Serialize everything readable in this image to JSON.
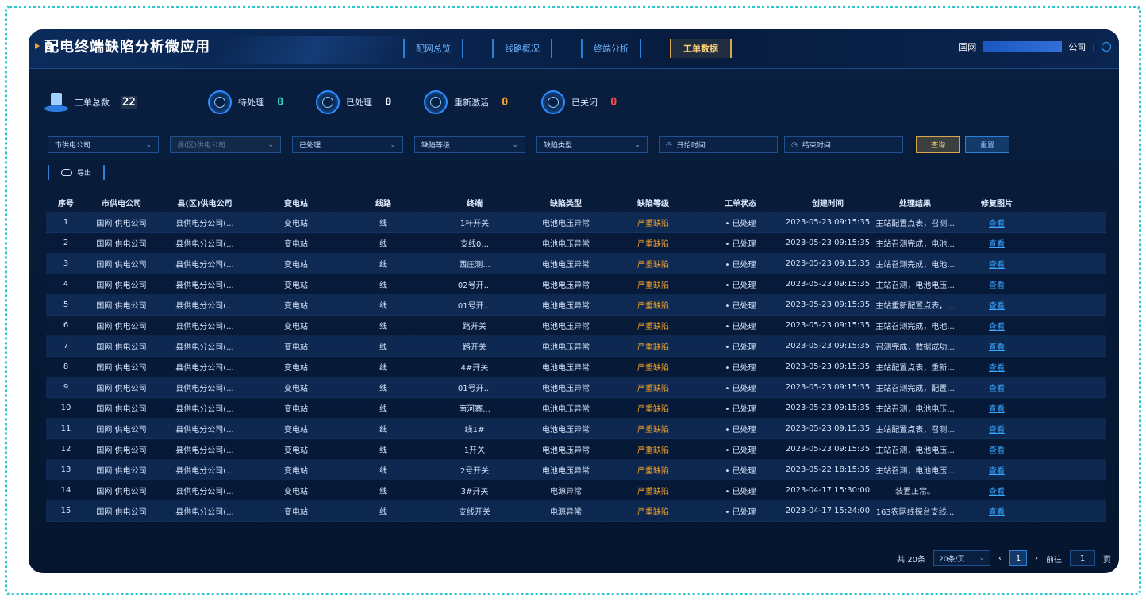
{
  "header": {
    "title": "配电终端缺陷分析微应用",
    "nav": [
      "配网总览",
      "线路概况",
      "终端分析",
      "工单数据"
    ],
    "active_nav": "工单数据",
    "org_prefix": "国网",
    "org_suffix": "公司",
    "separator": "|"
  },
  "stats": {
    "total_label": "工单总数",
    "total_value": "22",
    "items": [
      {
        "label": "待处理",
        "value": "0",
        "color": "#2fd2c4"
      },
      {
        "label": "已处理",
        "value": "0",
        "color": "#ffffff"
      },
      {
        "label": "重新激活",
        "value": "0",
        "color": "#f3a12b"
      },
      {
        "label": "已关闭",
        "value": "0",
        "color": "#ff4a4a"
      }
    ]
  },
  "filters": {
    "city": "市供电公司",
    "county": "县(区)供电公司",
    "status": "已处理",
    "defect_level": "缺陷等级",
    "defect_type": "缺陷类型",
    "start_time": "开始时间",
    "end_time": "结束时间",
    "query_label": "查询",
    "reset_label": "重置",
    "export_label": "导出"
  },
  "table": {
    "columns": [
      "序号",
      "市供电公司",
      "县(区)供电公司",
      "变电站",
      "线路",
      "终端",
      "缺陷类型",
      "缺陷等级",
      "工单状态",
      "创建时间",
      "处理结果",
      "修复图片"
    ],
    "rows": [
      [
        "1",
        "国网 供电公司",
        "县供电分公司(...",
        "变电站",
        "线",
        "1杆开关",
        "电池电压异常",
        "严重缺陷",
        "已处理",
        "2023-05-23 09:15:35",
        "主站配置点表，召测...",
        "查看"
      ],
      [
        "2",
        "国网 供电公司",
        "县供电分公司(...",
        "变电站",
        "线",
        "支线0...",
        "电池电压异常",
        "严重缺陷",
        "已处理",
        "2023-05-23 09:15:35",
        "主站召测完成，电池...",
        "查看"
      ],
      [
        "3",
        "国网 供电公司",
        "县供电分公司(...",
        "变电站",
        "线",
        "西庄测...",
        "电池电压异常",
        "严重缺陷",
        "已处理",
        "2023-05-23 09:15:35",
        "主站召测完成，电池...",
        "查看"
      ],
      [
        "4",
        "国网 供电公司",
        "县供电分公司(...",
        "变电站",
        "线",
        "02号开...",
        "电池电压异常",
        "严重缺陷",
        "已处理",
        "2023-05-23 09:15:35",
        "主站召测，电池电压...",
        "查看"
      ],
      [
        "5",
        "国网 供电公司",
        "县供电分公司(...",
        "变电站",
        "线",
        "01号开...",
        "电池电压异常",
        "严重缺陷",
        "已处理",
        "2023-05-23 09:15:35",
        "主站重新配置点表，...",
        "查看"
      ],
      [
        "6",
        "国网 供电公司",
        "县供电分公司(...",
        "变电站",
        "线",
        "路开关",
        "电池电压异常",
        "严重缺陷",
        "已处理",
        "2023-05-23 09:15:35",
        "主站召测完成，电池...",
        "查看"
      ],
      [
        "7",
        "国网 供电公司",
        "县供电分公司(...",
        "变电站",
        "线",
        "路开关",
        "电池电压异常",
        "严重缺陷",
        "已处理",
        "2023-05-23 09:15:35",
        "召测完成，数据成功...",
        "查看"
      ],
      [
        "8",
        "国网 供电公司",
        "县供电分公司(...",
        "变电站",
        "线",
        "4#开关",
        "电池电压异常",
        "严重缺陷",
        "已处理",
        "2023-05-23 09:15:35",
        "主站配置点表，重新...",
        "查看"
      ],
      [
        "9",
        "国网 供电公司",
        "县供电分公司(...",
        "变电站",
        "线",
        "01号开...",
        "电池电压异常",
        "严重缺陷",
        "已处理",
        "2023-05-23 09:15:35",
        "主站召测完成，配置...",
        "查看"
      ],
      [
        "10",
        "国网 供电公司",
        "县供电分公司(...",
        "变电站",
        "线",
        "南河寨...",
        "电池电压异常",
        "严重缺陷",
        "已处理",
        "2023-05-23 09:15:35",
        "主站召测，电池电压...",
        "查看"
      ],
      [
        "11",
        "国网 供电公司",
        "县供电分公司(...",
        "变电站",
        "线",
        "线1#",
        "电池电压异常",
        "严重缺陷",
        "已处理",
        "2023-05-23 09:15:35",
        "主站配置点表，召测...",
        "查看"
      ],
      [
        "12",
        "国网 供电公司",
        "县供电分公司(...",
        "变电站",
        "线",
        "1开关",
        "电池电压异常",
        "严重缺陷",
        "已处理",
        "2023-05-23 09:15:35",
        "主站召测，电池电压...",
        "查看"
      ],
      [
        "13",
        "国网 供电公司",
        "县供电分公司(...",
        "变电站",
        "线",
        "2号开关",
        "电池电压异常",
        "严重缺陷",
        "已处理",
        "2023-05-22 18:15:35",
        "主站召测，电池电压...",
        "查看"
      ],
      [
        "14",
        "国网 供电公司",
        "县供电分公司(...",
        "变电站",
        "线",
        "3#开关",
        "电源异常",
        "严重缺陷",
        "已处理",
        "2023-04-17 15:30:00",
        "装置正常。",
        "查看"
      ],
      [
        "15",
        "国网 供电公司",
        "县供电分公司(...",
        "变电站",
        "线",
        "支线开关",
        "电源异常",
        "严重缺陷",
        "已处理",
        "2023-04-17 15:24:00",
        "163农网线探台支线...",
        "查看"
      ]
    ]
  },
  "pagination": {
    "total": "共 20条",
    "page_size": "20条/页",
    "prev": "‹",
    "current": "1",
    "next": "›",
    "goto_label": "前往",
    "goto_value": "1",
    "page_unit": "页"
  },
  "colors": {
    "accent": "#2d7fd8",
    "active": "#d9a74a",
    "severity": "#f3a12b",
    "link": "#3aa6ff"
  }
}
